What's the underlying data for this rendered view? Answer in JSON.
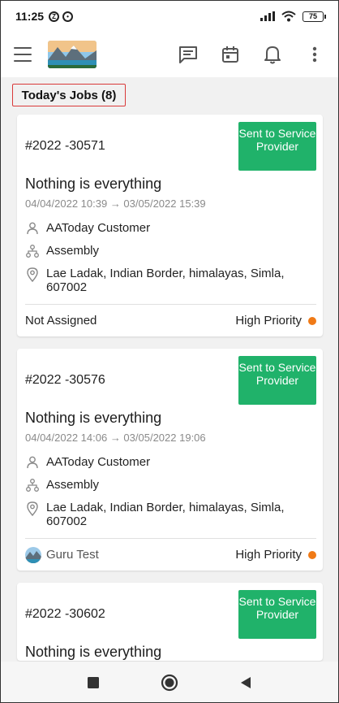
{
  "status_bar": {
    "time": "11:25",
    "battery": "75"
  },
  "app_bar": {
    "icons": [
      "menu-icon",
      "logo",
      "chat-icon",
      "calendar-icon",
      "bell-icon",
      "more-vert-icon"
    ]
  },
  "section": {
    "title": "Today's Jobs (8)"
  },
  "jobs": [
    {
      "number": "#2022 -30571",
      "status": "Sent to Service Provider",
      "title": "Nothing is everything",
      "dates": "04/04/2022 10:39 → 03/05/2022 15:39",
      "customer": "AAToday Customer",
      "category": "Assembly",
      "address": "Lae Ladak, Indian Border, himalayas, Simla, 607002",
      "assignee": "Not Assigned",
      "priority": "High Priority"
    },
    {
      "number": "#2022 -30576",
      "status": "Sent to Service Provider",
      "title": "Nothing is everything",
      "dates": "04/04/2022 14:06 → 03/05/2022 19:06",
      "customer": "AAToday Customer",
      "category": "Assembly",
      "address": "Lae Ladak, Indian Border, himalayas, Simla, 607002",
      "assignee": "Guru Test",
      "priority": "High Priority"
    },
    {
      "number": "#2022 -30602",
      "status": "Sent to Service Provider",
      "title": "Nothing is everything"
    }
  ],
  "colors": {
    "status_green": "#20b26a",
    "priority_orange": "#f07a16",
    "highlight_red": "#d93a3a"
  }
}
